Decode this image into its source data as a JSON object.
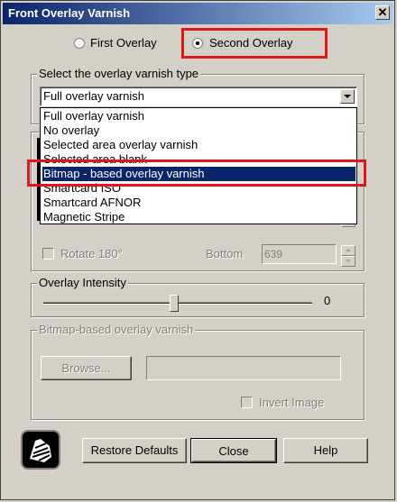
{
  "window": {
    "title": "Front Overlay Varnish",
    "close_glyph": "✕"
  },
  "overlay_choice": {
    "first_label": "First Overlay",
    "second_label": "Second Overlay",
    "selected": "second"
  },
  "varnish_type": {
    "group_label": "Select the overlay varnish type",
    "current_value": "Full overlay varnish",
    "options": [
      "Full overlay varnish",
      "No overlay",
      "Selected area overlay varnish",
      "Selected area blank",
      "Bitmap - based overlay varnish",
      "Smartcard ISO",
      "Smartcard AFNOR",
      "Magnetic Stripe"
    ],
    "highlighted_index": 4
  },
  "area": {
    "rotate_label": "Rotate 180°",
    "bottom_label": "Bottom",
    "bottom_value": "639"
  },
  "intensity": {
    "group_label": "Overlay Intensity",
    "value": "0"
  },
  "bitmap": {
    "group_label": "Bitmap-based overlay varnish",
    "browse_label": "Browse...",
    "path_value": "",
    "invert_label": "Invert Image"
  },
  "footer": {
    "restore_label": "Restore Defaults",
    "close_label": "Close",
    "help_label": "Help"
  },
  "colors": {
    "highlight": "#e0161a",
    "selection": "#0a246a",
    "titlebar": "#0a246a"
  }
}
